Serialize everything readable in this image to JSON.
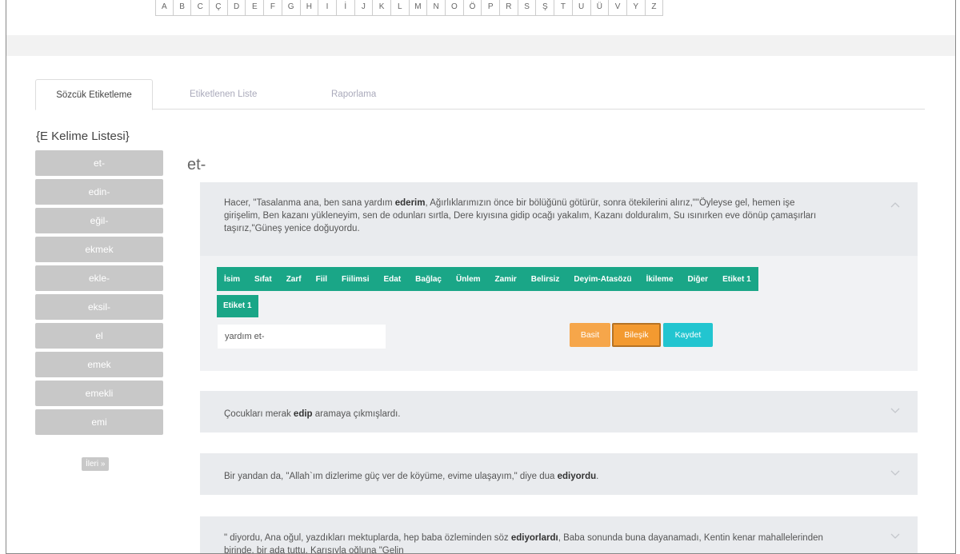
{
  "alphabet": [
    "A",
    "B",
    "C",
    "Ç",
    "D",
    "E",
    "F",
    "G",
    "H",
    "I",
    "İ",
    "J",
    "K",
    "L",
    "M",
    "N",
    "O",
    "Ö",
    "P",
    "R",
    "S",
    "Ş",
    "T",
    "U",
    "Ü",
    "V",
    "Y",
    "Z"
  ],
  "tabs": [
    {
      "label": "Sözcük Etiketleme"
    },
    {
      "label": "Etiketlenen Liste"
    },
    {
      "label": "Raporlama"
    }
  ],
  "sidebar": {
    "title": "{E Kelime Listesi}",
    "words": [
      "et-",
      "edin-",
      "eğil-",
      "ekmek",
      "ekle-",
      "eksil-",
      "el",
      "emek",
      "emekli",
      "emi"
    ],
    "next_label": "İleri »"
  },
  "main": {
    "heading": "et-",
    "sentences": [
      {
        "pre": "Hacer, \"Tasalanma ana, ben sana yardım ",
        "bold": "ederim",
        "post": ", Ağırlıklarımızın önce bir bölüğünü götürür, sonra ötekilerini alırız,\"\"Öyleyse gel, hemen işe girişelim, Ben kazanı yükleneyim, sen de odunları sırtla, Dere kıyısına gidip ocağı yakalım, Kazanı dolduralım, Su ısınırken eve dönüp çamaşırları taşırız,\"Güneş yenice doğuyordu."
      },
      {
        "pre": "Çocukları merak ",
        "bold": "edip",
        "post": " aramaya çıkmışlardı."
      },
      {
        "pre": "Bir yandan da, \"Allah`ım dizlerime güç ver de köyüme, evime ulaşayım,\" diye dua ",
        "bold": "ediyordu",
        "post": "."
      },
      {
        "pre": "\" diyordu, Ana oğul, yazdıkları mektuplarda, hep baba özleminden söz ",
        "bold": "ediyorlardı",
        "post": ", Baba sonunda buna dayanamadı, Kentin kenar mahallelerinden birinde, bir ada tuttu. Karısıyla oğluna \"Gelin"
      }
    ],
    "tags": [
      "İsim",
      "Sıfat",
      "Zarf",
      "Fiil",
      "Fiilimsi",
      "Edat",
      "Bağlaç",
      "Ünlem",
      "Zamir",
      "Belirsiz",
      "Deyim-Atasözü",
      "İkileme",
      "Diğer",
      "Etiket 1"
    ],
    "tag_extra": "Etiket 1",
    "input_value": "yardım et-",
    "buttons": {
      "basit": "Basit",
      "bilesik": "Bileşik",
      "kaydet": "Kaydet"
    }
  },
  "colors": {
    "accent_green": "#1aa687",
    "orange": "#f6a64a",
    "cyan": "#22c5d0",
    "panel_gray": "#e9ebee"
  }
}
